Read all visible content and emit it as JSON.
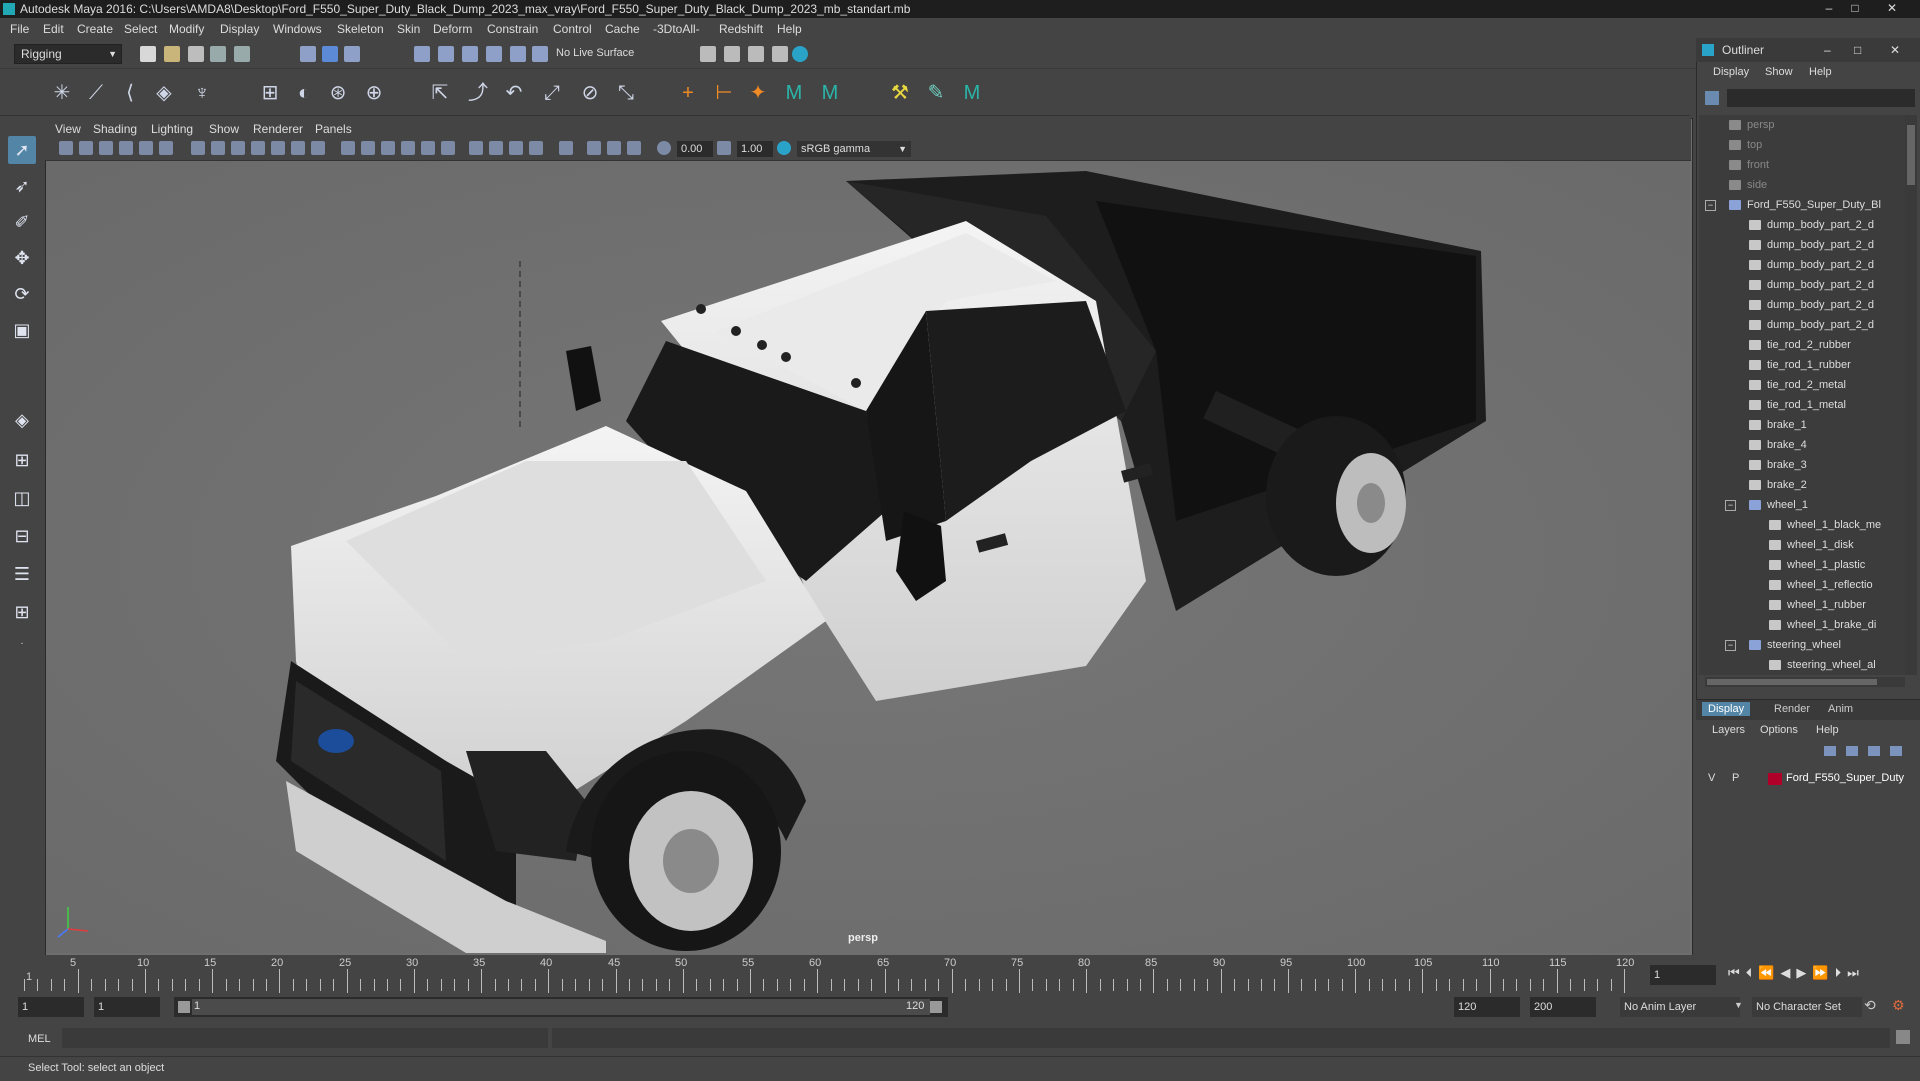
{
  "window": {
    "title": "Autodesk Maya 2016: C:\\Users\\AMDA8\\Desktop\\Ford_F550_Super_Duty_Black_Dump_2023_max_vray\\Ford_F550_Super_Duty_Black_Dump_2023_mb_standart.mb",
    "min": "–",
    "max": "□",
    "close": "✕"
  },
  "menubar": [
    "File",
    "Edit",
    "Create",
    "Select",
    "Modify",
    "Display",
    "Windows",
    "Skeleton",
    "Skin",
    "Deform",
    "Constrain",
    "Control",
    "Cache",
    "-3DtoAll-",
    "Redshift",
    "Help"
  ],
  "statusline": {
    "mode": "Rigging",
    "live_surface": "No Live Surface"
  },
  "panel": {
    "menus": [
      "View",
      "Shading",
      "Lighting",
      "Show",
      "Renderer",
      "Panels"
    ],
    "exposure": "0.00",
    "gamma": "1.00",
    "colorspace": "sRGB gamma",
    "camera_label": "persp"
  },
  "outliner": {
    "title": "Outliner",
    "menus": [
      "Display",
      "Show",
      "Help"
    ],
    "items": [
      {
        "label": "persp",
        "indent": 0,
        "dim": true
      },
      {
        "label": "top",
        "indent": 0,
        "dim": true
      },
      {
        "label": "front",
        "indent": 0,
        "dim": true
      },
      {
        "label": "side",
        "indent": 0,
        "dim": true
      },
      {
        "label": "Ford_F550_Super_Duty_Bl",
        "indent": 0,
        "group": true
      },
      {
        "label": "dump_body_part_2_d",
        "indent": 1
      },
      {
        "label": "dump_body_part_2_d",
        "indent": 1
      },
      {
        "label": "dump_body_part_2_d",
        "indent": 1
      },
      {
        "label": "dump_body_part_2_d",
        "indent": 1
      },
      {
        "label": "dump_body_part_2_d",
        "indent": 1
      },
      {
        "label": "dump_body_part_2_d",
        "indent": 1
      },
      {
        "label": "tie_rod_2_rubber",
        "indent": 1
      },
      {
        "label": "tie_rod_1_rubber",
        "indent": 1
      },
      {
        "label": "tie_rod_2_metal",
        "indent": 1
      },
      {
        "label": "tie_rod_1_metal",
        "indent": 1
      },
      {
        "label": "brake_1",
        "indent": 1
      },
      {
        "label": "brake_4",
        "indent": 1
      },
      {
        "label": "brake_3",
        "indent": 1
      },
      {
        "label": "brake_2",
        "indent": 1
      },
      {
        "label": "wheel_1",
        "indent": 1,
        "group": true
      },
      {
        "label": "wheel_1_black_me",
        "indent": 2
      },
      {
        "label": "wheel_1_disk",
        "indent": 2
      },
      {
        "label": "wheel_1_plastic",
        "indent": 2
      },
      {
        "label": "wheel_1_reflectio",
        "indent": 2
      },
      {
        "label": "wheel_1_rubber",
        "indent": 2
      },
      {
        "label": "wheel_1_brake_di",
        "indent": 2
      },
      {
        "label": "steering_wheel",
        "indent": 1,
        "group": true
      },
      {
        "label": "steering_wheel_al",
        "indent": 2
      }
    ]
  },
  "layer_editor": {
    "tabs": [
      "Display",
      "Render",
      "Anim"
    ],
    "menus": [
      "Layers",
      "Options",
      "Help"
    ],
    "layer": {
      "v": "V",
      "p": "P",
      "name": "Ford_F550_Super_Duty",
      "color": "#b0002a"
    }
  },
  "timeline": {
    "labels": [
      "5",
      "10",
      "15",
      "20",
      "25",
      "30",
      "35",
      "40",
      "45",
      "50",
      "55",
      "60",
      "65",
      "70",
      "75",
      "80",
      "85",
      "90",
      "95",
      "100",
      "105",
      "110",
      "115",
      "120"
    ],
    "start_label": "1",
    "current_frame": "1"
  },
  "range": {
    "start": "1",
    "playback_start": "1",
    "slider_start": "1",
    "slider_end": "120",
    "playback_end": "120",
    "end": "200",
    "anim_layer": "No Anim Layer",
    "character_set": "No Character Set"
  },
  "command": {
    "label": "MEL"
  },
  "help": {
    "text": "Select Tool: select an object"
  }
}
